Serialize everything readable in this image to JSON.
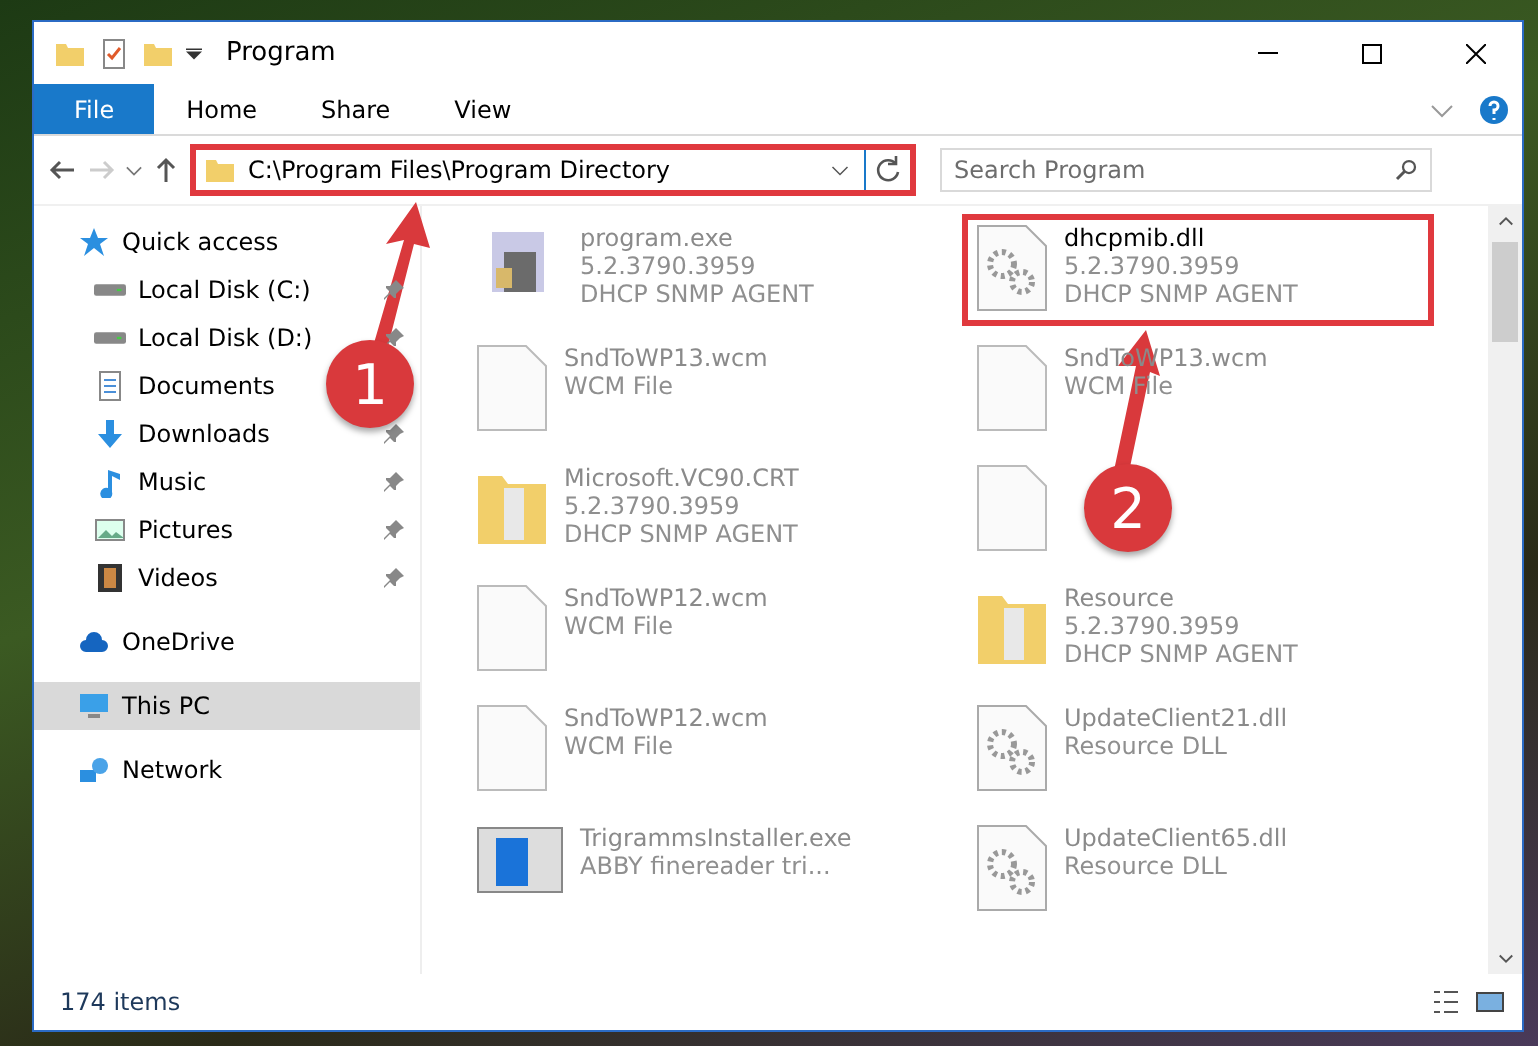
{
  "window": {
    "title": "Program"
  },
  "ribbon_tabs": [
    {
      "label": "File",
      "selected": true
    },
    {
      "label": "Home",
      "selected": false
    },
    {
      "label": "Share",
      "selected": false
    },
    {
      "label": "View",
      "selected": false
    }
  ],
  "address_bar": {
    "path": "C:\\Program Files\\Program Directory",
    "highlighted": true
  },
  "search": {
    "placeholder": "Search Program"
  },
  "sidebar": {
    "items": [
      {
        "label": "Quick access",
        "kind": "star",
        "selected": false,
        "children": [
          {
            "label": "Local Disk (C:)",
            "kind": "drive",
            "pinned": true,
            "selected": false
          },
          {
            "label": "Local Disk (D:)",
            "kind": "drive",
            "pinned": true,
            "selected": false
          },
          {
            "label": "Documents",
            "kind": "documents",
            "selected": false
          },
          {
            "label": "Downloads",
            "kind": "downloads",
            "pinned": true,
            "selected": false
          },
          {
            "label": "Music",
            "kind": "music",
            "pinned": true,
            "selected": false
          },
          {
            "label": "Pictures",
            "kind": "pictures",
            "pinned": true,
            "selected": false
          },
          {
            "label": "Videos",
            "kind": "videos",
            "pinned": true,
            "selected": false
          }
        ]
      },
      {
        "label": "OneDrive",
        "kind": "cloud",
        "selected": false
      },
      {
        "label": "This PC",
        "kind": "pc",
        "selected": true
      },
      {
        "label": "Network",
        "kind": "network",
        "selected": false
      }
    ]
  },
  "files": [
    {
      "name": "program.exe",
      "lines": [
        "5.2.3790.3959",
        "DHCP SNMP AGENT"
      ],
      "kind": "exe",
      "highlighted": false
    },
    {
      "name": "dhcpmib.dll",
      "lines": [
        "5.2.3790.3959",
        "DHCP SNMP AGENT"
      ],
      "kind": "dll",
      "highlighted": true
    },
    {
      "name": "SndToWP13.wcm",
      "lines": [
        "WCM File"
      ],
      "kind": "file",
      "highlighted": false
    },
    {
      "name": "SndToWP13.wcm",
      "lines": [
        "WCM File"
      ],
      "kind": "file",
      "highlighted": false
    },
    {
      "name": "Microsoft.VC90.CRT",
      "lines": [
        "5.2.3790.3959",
        "DHCP SNMP AGENT"
      ],
      "kind": "folder",
      "highlighted": false
    },
    {
      "kind": "file",
      "highlighted": false
    },
    {
      "name": "SndToWP12.wcm",
      "lines": [
        "WCM File"
      ],
      "kind": "file",
      "highlighted": false
    },
    {
      "name": "Resource",
      "lines": [
        "5.2.3790.3959",
        "DHCP SNMP AGENT"
      ],
      "kind": "folder",
      "highlighted": false
    },
    {
      "name": "SndToWP12.wcm",
      "lines": [
        "WCM File"
      ],
      "kind": "file",
      "highlighted": false
    },
    {
      "name": "UpdateClient21.dll",
      "lines": [
        "Resource DLL"
      ],
      "kind": "dll",
      "highlighted": false
    },
    {
      "name": "TrigrammsInstaller.exe",
      "lines": [
        "ABBY finereader tri..."
      ],
      "kind": "installer",
      "highlighted": false
    },
    {
      "name": "UpdateClient65.dll",
      "lines": [
        "Resource DLL"
      ],
      "kind": "dll",
      "highlighted": false
    }
  ],
  "status_bar": {
    "count": "174 items"
  },
  "annotations": [
    {
      "number": "1"
    },
    {
      "number": "2"
    }
  ]
}
